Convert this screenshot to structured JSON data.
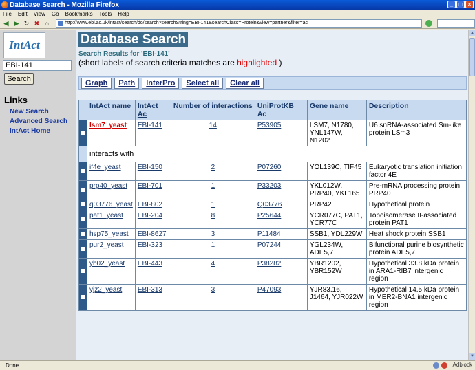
{
  "window": {
    "title": "Database Search - Mozilla Firefox"
  },
  "menu": [
    "File",
    "Edit",
    "View",
    "Go",
    "Bookmarks",
    "Tools",
    "Help"
  ],
  "address": {
    "url": "http://www.ebi.ac.uk/intact/search/do/search?searchString=EBI-141&searchClass=Protein&view=partner&filter=ac"
  },
  "sidebar": {
    "logo_text": "IntAct",
    "search_value": "EBI-141",
    "search_button": "Search",
    "links_heading": "Links",
    "links": [
      "New Search",
      "Advanced Search",
      "IntAct Home"
    ]
  },
  "main": {
    "title": "Database Search",
    "results_for": "Search Results for 'EBI-141'",
    "hint_before": "(short labels of search criteria matches are ",
    "hint_highlight": "highlighted",
    "hint_after": " )",
    "actions": [
      "Graph",
      "Path",
      "InterPro",
      "Select all",
      "Clear all"
    ]
  },
  "table": {
    "headers": [
      "IntAct name",
      "IntAct Ac",
      "Number of interactions",
      "UniProtKB Ac",
      "Gene name",
      "Description"
    ],
    "query": {
      "name": "lsm7_yeast",
      "ac": "EBI-141",
      "count": "14",
      "uniprot": "P53905",
      "gene": "LSM7, N1780, YNL147W, N1202",
      "desc": "U6 snRNA-associated Sm-like protein LSm3"
    },
    "interacts_label": "interacts with",
    "rows": [
      {
        "name": "if4e_yeast",
        "ac": "EBI-150",
        "count": "2",
        "uniprot": "P07260",
        "gene": "YOL139C, TIF45",
        "desc": "Eukaryotic translation initiation factor 4E"
      },
      {
        "name": "prp40_yeast",
        "ac": "EBI-701",
        "count": "1",
        "uniprot": "P33203",
        "gene": "YKL012W, PRP40, YKL165",
        "desc": "Pre-mRNA processing protein PRP40"
      },
      {
        "name": "q03776_yeast",
        "ac": "EBI-802",
        "count": "1",
        "uniprot": "Q03776",
        "gene": "PRP42",
        "desc": "Hypothetical protein"
      },
      {
        "name": "pat1_yeast",
        "ac": "EBI-204",
        "count": "8",
        "uniprot": "P25644",
        "gene": "YCR077C, PAT1, YCR77C",
        "desc": "Topoisomerase II-associated protein PAT1"
      },
      {
        "name": "hsp75_yeast",
        "ac": "EBI-8627",
        "count": "3",
        "uniprot": "P11484",
        "gene": "SSB1, YDL229W",
        "desc": "Heat shock protein SSB1"
      },
      {
        "name": "pur2_yeast",
        "ac": "EBI-323",
        "count": "1",
        "uniprot": "P07244",
        "gene": "YGL234W, ADE5,7",
        "desc": "Bifunctional purine biosynthetic protein ADE5,7"
      },
      {
        "name": "yb02_yeast",
        "ac": "EBI-443",
        "count": "4",
        "uniprot": "P38282",
        "gene": "YBR1202, YBR152W",
        "desc": "Hypothetical 33.8 kDa protein in ARA1-RIB7 intergenic region"
      },
      {
        "name": "yjz2_yeast",
        "ac": "EBI-313",
        "count": "3",
        "uniprot": "P47093",
        "gene": "YJR83.16, J1464, YJR022W",
        "desc": "Hypothetical 14.5 kDa protein in MER2-BNA1 intergenic region"
      }
    ]
  },
  "status": {
    "text": "Done",
    "adblock": "Adblock"
  }
}
